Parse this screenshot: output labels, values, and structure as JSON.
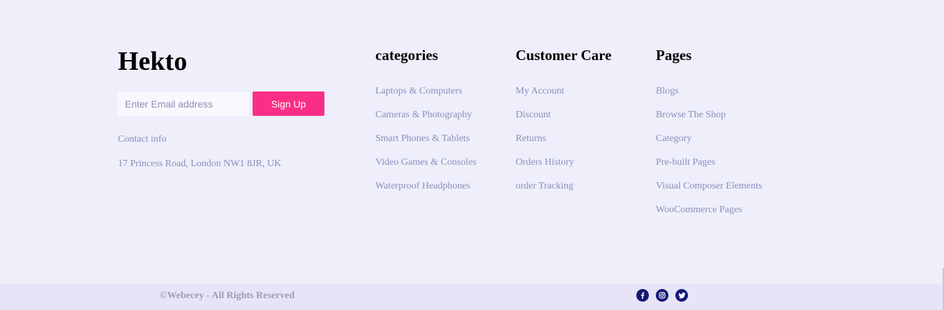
{
  "brand": {
    "name": "Hekto"
  },
  "newsletter": {
    "placeholder": "Enter Email address",
    "button_label": "Sign Up"
  },
  "contact": {
    "label": "Contact info",
    "address": "17 Princess Road, London NW1 8JR, UK"
  },
  "columns": [
    {
      "title": "categories",
      "links": [
        "Laptops & Computers",
        "Cameras & Photography",
        "Smart Phones & Tablets",
        "Video Games & Consoles",
        "Waterproof Headphones"
      ]
    },
    {
      "title": "Customer Care",
      "links": [
        "My Account",
        "Discount",
        "Returns",
        "Orders History",
        "order Tracking"
      ]
    },
    {
      "title": "Pages",
      "links": [
        "Blogs",
        "Browse The Shop",
        "Category",
        "Pre-built Pages",
        "Visual Composer Elements",
        "WooCommerce Pages"
      ]
    }
  ],
  "bottom": {
    "copyright": "©Webecey - All Rights Reserved",
    "social_icons": [
      "facebook-icon",
      "instagram-icon",
      "twitter-icon"
    ],
    "icon_color": "#151875"
  },
  "colors": {
    "accent": "#fb2e86",
    "link": "#8a8fb9",
    "background": "#eeeffb",
    "bottom_bar": "#e7e4f8"
  }
}
